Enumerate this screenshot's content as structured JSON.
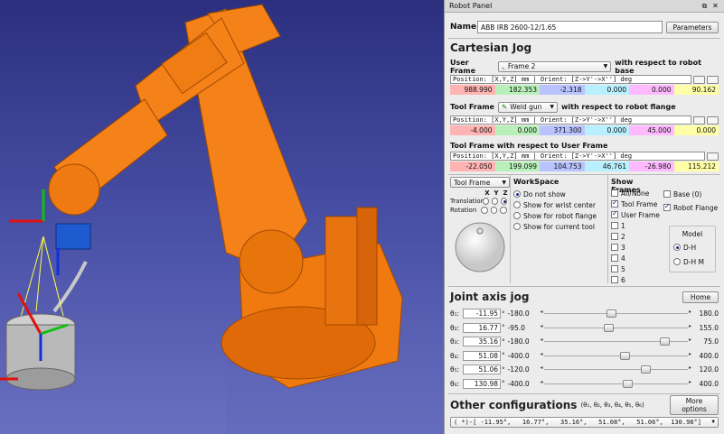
{
  "panel": {
    "title": "Robot Panel",
    "icons": [
      "restore-icon",
      "close-icon"
    ],
    "name_label": "Name:",
    "name_value": "ABB IRB 2600-12/1.65",
    "parameters_button": "Parameters"
  },
  "cartesian": {
    "title": "Cartesian Jog",
    "user_frame_label": "User Frame",
    "user_frame_value": "Frame 2",
    "user_frame_suffix": "with respect to robot base",
    "header": "Position: [X,Y,Z] mm | Orient: [Z->Y'->X''] deg",
    "user_values": [
      "988.990",
      "182.353",
      "-2.318",
      "0.000",
      "0.000",
      "90.162"
    ],
    "tool_frame_label": "Tool Frame",
    "tool_frame_value": "Weld gun",
    "tool_frame_suffix": "with respect to robot flange",
    "tool_values": [
      "-4.000",
      "0.000",
      "371.300",
      "0.000",
      "45.000",
      "0.000"
    ],
    "tool_user_label": "Tool Frame with respect to User Frame",
    "tool_user_values": [
      "-22.050",
      "199.099",
      "104.753",
      "46.761",
      "-26.980",
      "115.212"
    ],
    "value_colors": [
      "#ffb3b3",
      "#b9f0b9",
      "#b9c4ff",
      "#b9f0ff",
      "#ffb9ff",
      "#ffffa8"
    ]
  },
  "jog": {
    "frame_combo": "Tool Frame",
    "axes": [
      "X",
      "Y",
      "Z"
    ],
    "translation_label": "Translation",
    "rotation_label": "Rotation",
    "translation_selected": 2
  },
  "workspace": {
    "title": "WorkSpace",
    "options": [
      "Do not show",
      "Show for wrist center",
      "Show for robot flange",
      "Show for current tool"
    ],
    "selected": 0
  },
  "show_frames": {
    "title": "Show Frames",
    "items": [
      {
        "label": "All/None",
        "checked": false
      },
      {
        "label": "Tool Frame",
        "checked": true
      },
      {
        "label": "User Frame",
        "checked": true
      },
      {
        "label": "1",
        "checked": false
      },
      {
        "label": "2",
        "checked": false
      },
      {
        "label": "3",
        "checked": false
      },
      {
        "label": "4",
        "checked": false
      },
      {
        "label": "5",
        "checked": false
      },
      {
        "label": "6",
        "checked": false
      }
    ],
    "base_label": "Base (0)",
    "base_checked": false,
    "flange_label": "Robot Flange",
    "flange_checked": true
  },
  "model": {
    "title": "Model",
    "options": [
      "D-H",
      "D-H M"
    ],
    "selected": 0
  },
  "joints": {
    "title": "Joint axis jog",
    "home_button": "Home",
    "rows": [
      {
        "label": "θ₁:",
        "value": "-11.95",
        "min": "-180.0",
        "max": "180.0",
        "frac": 0.467
      },
      {
        "label": "θ₂:",
        "value": "16.77",
        "min": "-95.0",
        "max": "155.0",
        "frac": 0.447
      },
      {
        "label": "θ₃:",
        "value": "35.16",
        "min": "-180.0",
        "max": "75.0",
        "frac": 0.844
      },
      {
        "label": "θ₄:",
        "value": "51.08",
        "min": "-400.0",
        "max": "400.0",
        "frac": 0.564
      },
      {
        "label": "θ₅:",
        "value": "51.06",
        "min": "-120.0",
        "max": "120.0",
        "frac": 0.713
      },
      {
        "label": "θ₆:",
        "value": "130.98",
        "min": "-400.0",
        "max": "400.0",
        "frac": 0.582
      }
    ]
  },
  "other": {
    "title": "Other configurations",
    "subtitle": "(θ₁, θ₂, θ₃, θ₄, θ₅, θ₆)",
    "more_button": "More options",
    "config_value": "( *)-[ -11.95°,   16.77°,   35.16°,   51.08°,   51.06°,  130.98°]"
  }
}
